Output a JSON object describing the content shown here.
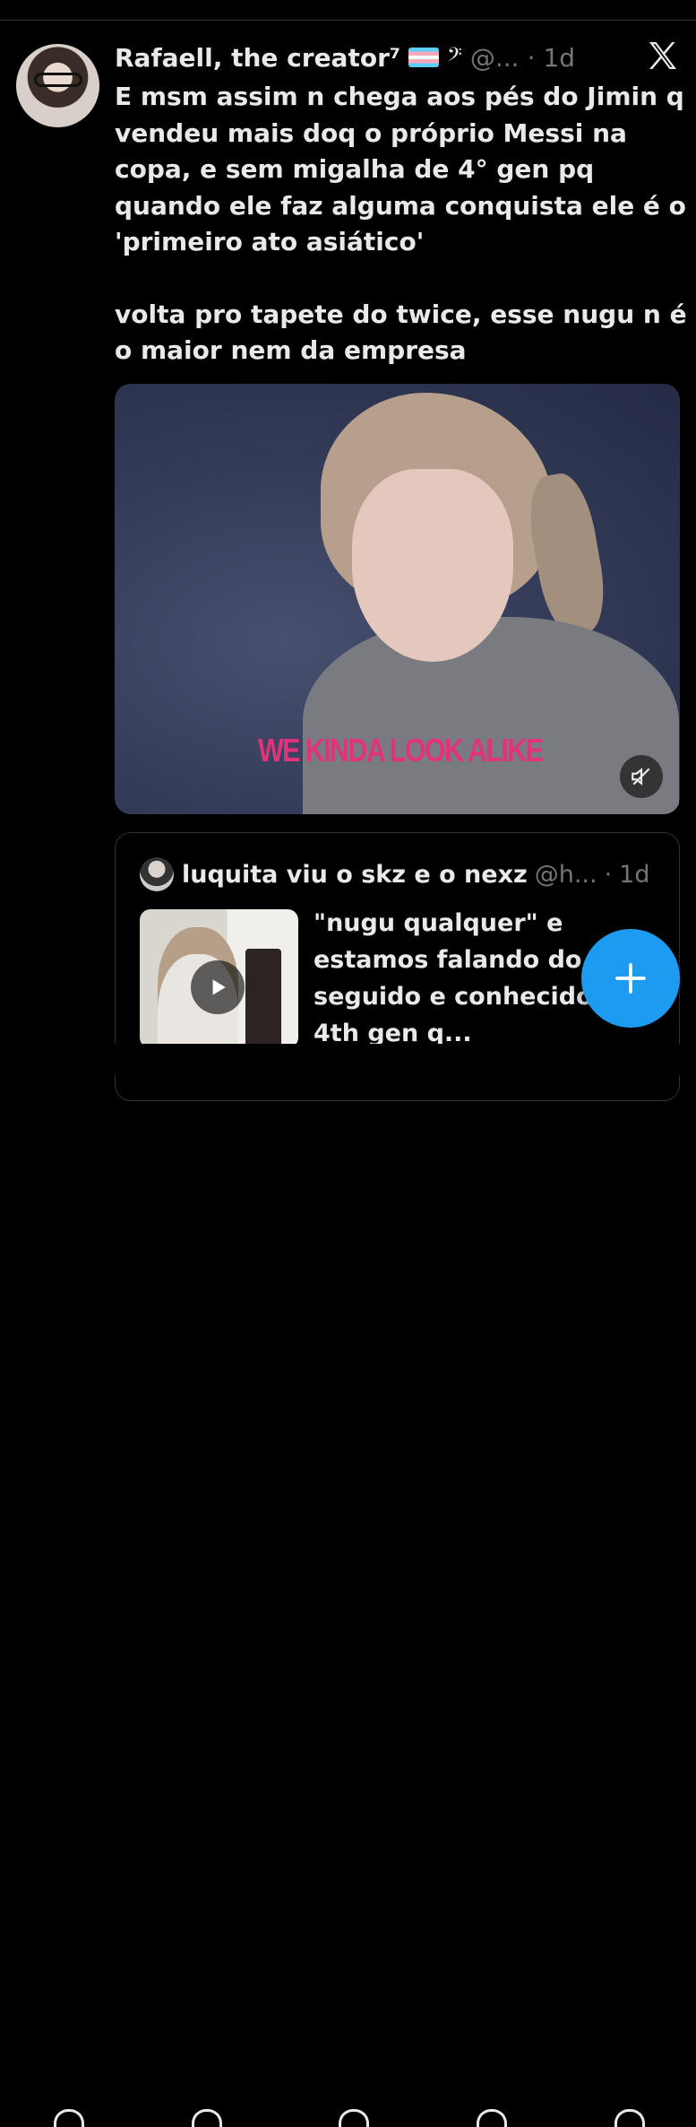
{
  "tweet": {
    "display_name": "Rafaell, the creator⁷",
    "handle": "@...",
    "separator": "·",
    "time": "1d",
    "paragraphs": [
      "E msm assim n chega aos pés do Jimin q vendeu mais doq o próprio Messi na copa, e sem migalha de 4° gen pq quando ele faz alguma conquista ele é o 'primeiro ato asiático'",
      "volta pro tapete do twice, esse nugu n é o maior nem da empresa"
    ],
    "media": {
      "caption": "WE KINDA LOOK ALIKE"
    }
  },
  "quote": {
    "display_name": "luquita viu o skz e o nexz",
    "handle": "@h...",
    "separator": "·",
    "time": "1d",
    "text": "\"nugu qualquer\" e estamos falando do i mais seguido e conhecido da 4th gen q..."
  },
  "icons": {
    "flag": "trans-flag-icon",
    "music": "bass-clef-icon",
    "logo": "x-logo-icon",
    "mute": "speaker-muted-icon",
    "play": "play-icon",
    "compose": "plus-icon"
  },
  "colors": {
    "background": "#000000",
    "text": "#e7e9ea",
    "muted": "#71767b",
    "accent": "#1d9bf0",
    "caption": "#e2337a"
  }
}
